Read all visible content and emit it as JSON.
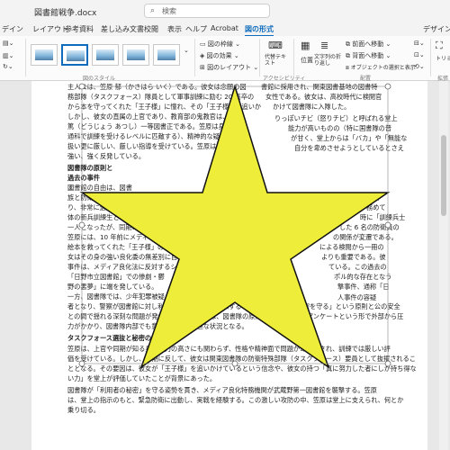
{
  "titlebar": {
    "doc_title": "図書館戦争.docx",
    "search_placeholder": "検索"
  },
  "tabs": [
    {
      "label": "デイン"
    },
    {
      "label": "レイアウト"
    },
    {
      "label": "参考資料"
    },
    {
      "label": "差し込み文書"
    },
    {
      "label": "校閲"
    },
    {
      "label": "表示"
    },
    {
      "label": "ヘルプ"
    },
    {
      "label": "Acrobat"
    },
    {
      "label": "図の形式",
      "active": true
    },
    {
      "label": "デザイン"
    }
  ],
  "ribbon": {
    "picture_styles_label": "図のスタイル",
    "accessibility_label": "アクセシビリティ",
    "arrange_label": "配置",
    "border_label": "図の枠線",
    "effects_label": "図の効果",
    "layout_label": "図のレイアウト",
    "alt_text_label": "代替テキスト",
    "position_label": "位置",
    "wrap_text_label": "文字列の折り返し",
    "bring_forward_label": "前面へ移動",
    "send_backward_label": "背面へ移動",
    "selection_pane_label": "オブジェクトの選択と表示",
    "crop_label": "トリミ",
    "right_panel_label": "拡張"
  },
  "document": {
    "lines": [
      "主人公は、笠原 郁（かさはら いく）である。彼女は念願の図",
      "務部隊（タスクフォース）隊員として軍事訓練に励む 20 高卒の",
      "から本を守ってくれた「王子様」に憧れ、その「王子様」を追いか",
      "しかし、彼女の直属の上官であり、教育部の鬼教官は、怒",
      "篤（どうじょう あつし）一等図書正である。笠原は身体",
      "通科で訓練を受けるレベルに匹敵する）、精神的な疑い",
      "扱い更に厳しい、厳しい指導を受けている。笠原は上",
      "強い、強く反発している。",
      "図書隊の原則と",
      "過去の事件",
      "図書館の自由は、図書",
      "族と防衛（戦闘）業務を兼",
      "り、非常に過酷である。笠原は入隊",
      "体の新兵訓練生として、堂上教官が任命",
      "一人となったが、同期のなかでも特に堂上と",
      "笠原には、10 年前にメディア良化委員会",
      "絵本を救ってくれた「王子様」の記憶が何",
      "女はその身の強い良化委の無差別に自",
      "事件は、メディア良化法に反対するシン",
      "「日野市立図書館」での惨劇・鬱",
      "野の悪夢」に端を発している。",
      "一方、図書隊では、少年犯罪被疑",
      "者となり、警察が図書館に対し利用者の貸出記録を要求するという、「利用者の秘密を守る」という原則と公の安全",
      "との間で揺れる深刻な問題が発生する。この事件は、図書隊の原則への賛否を問うアンケートという形で外部から圧",
      "力がかかり、図書隊内部でも意見が割れる緊迫な状況となる。",
      "タスクフォース選抜と秘密の共有",
      "笠原は、上官や同期が知る身体能力の高さにも関わらず、性格や精神面で問題があるとされ、訓練では厳しい評",
      "価を受けている。しかし、予期に反して、彼女は関東図書隊の防衛特殊部隊（タスクフォース）要員として抜擢されるこ",
      "ととなる。その要因は、彼女が「王子様」を追いかけているという信念や、彼女の持つ「真に努力した者にしか持ち得な",
      "い力」を堂上が評価していたことが背景にあった。",
      "図書隊が「利用者の秘密」を守る姿勢を貫き、メディア良化特務機関が武蔵野第一図書館を襲撃する。笠原",
      "は、堂上の指示のもと、緊急防衛に出動し、実戦を経験する。この激しい攻防の中、笠原は堂上に支えられ、何とか",
      "乗り切る。"
    ],
    "right_lines": [
      "書館に採用され、関東図書基地の図書特",
      "女性である。彼女は、高校時代に検閲官",
      "かけて図書隊に入隊した。",
      "りっぽいチビ（怒りチビ）と呼ばれる堂上",
      "能力が高いものの（特に国書隊の普",
      "が甘く、堂上からは「バカ」や「無能な",
      "自分を卑めさせようとしているとさえ",
      "雑業",
      "務めて",
      "時に「訓練兵士",
      "した 6 名の防衛員の",
      "の関係が変遷である。",
      "による検閲から一冊の",
      "よりも重要である。彼",
      "ている。この過去の",
      "ポル的な存在となう",
      "撃事件、通称「日",
      "人事件の容疑"
    ]
  }
}
